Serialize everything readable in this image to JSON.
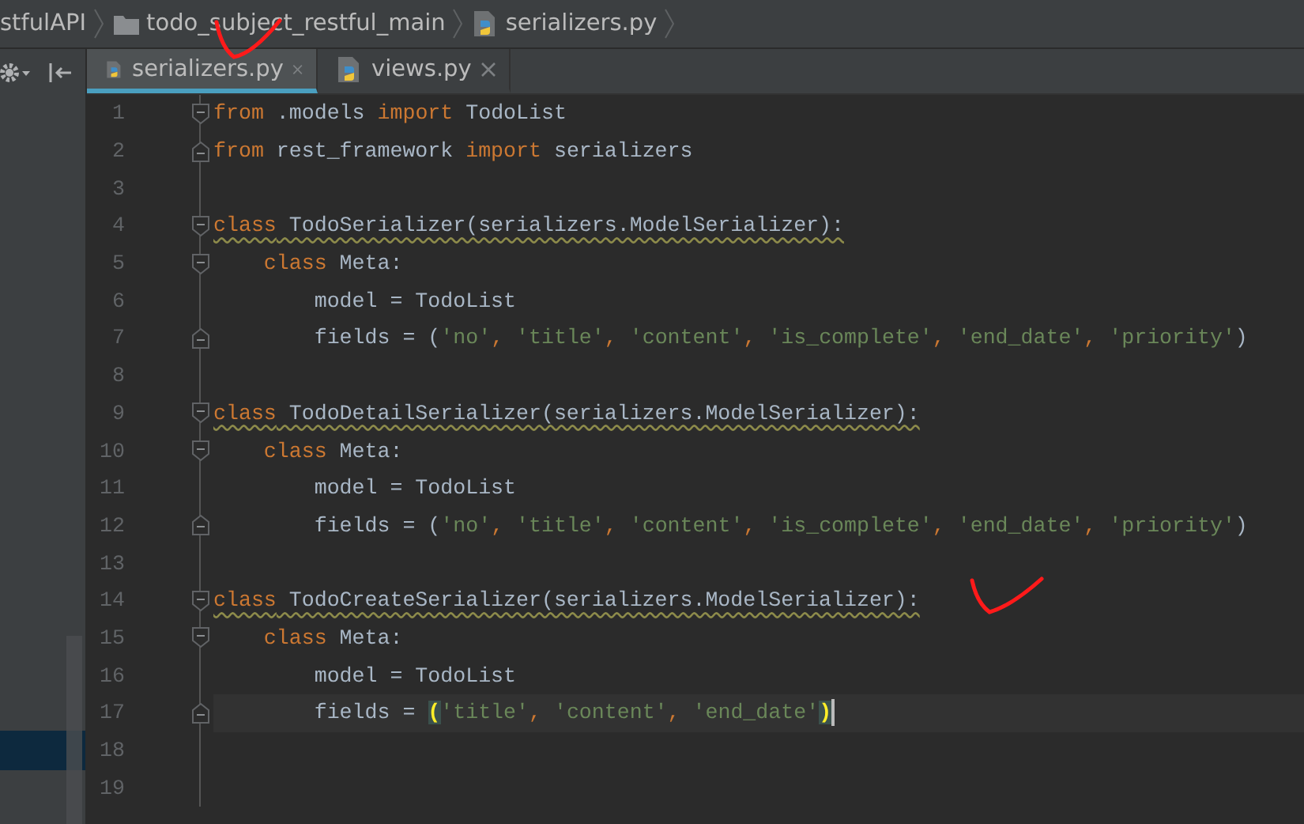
{
  "breadcrumbs": [
    {
      "kind": "project",
      "label": "stfulAPI"
    },
    {
      "kind": "folder",
      "label": "todo_subject_restful_main"
    },
    {
      "kind": "python-file",
      "label": "serializers.py"
    }
  ],
  "tabs": [
    {
      "label": "serializers.py",
      "selected": true
    },
    {
      "label": "views.py",
      "selected": false
    }
  ],
  "editor": {
    "lines": [
      {
        "number": "1",
        "fold_start": true,
        "fold_end": false,
        "warning": false,
        "current": false,
        "tokens": [
          {
            "kind": "keyword",
            "text": "from"
          },
          {
            "kind": "plain",
            "text": " .models "
          },
          {
            "kind": "keyword",
            "text": "import"
          },
          {
            "kind": "plain",
            "text": " TodoList"
          }
        ]
      },
      {
        "number": "2",
        "fold_start": false,
        "fold_end": true,
        "warning": false,
        "current": false,
        "tokens": [
          {
            "kind": "keyword",
            "text": "from"
          },
          {
            "kind": "plain",
            "text": " rest_framework "
          },
          {
            "kind": "keyword",
            "text": "import"
          },
          {
            "kind": "plain",
            "text": " serializers"
          }
        ]
      },
      {
        "number": "3",
        "fold_start": false,
        "fold_end": false,
        "current": false
      },
      {
        "number": "4",
        "fold_start": true,
        "fold_end": false,
        "warning": true,
        "current": false,
        "tokens": [
          {
            "kind": "keyword",
            "text": "class"
          },
          {
            "kind": "plain",
            "text": " TodoSerializer(serializers.ModelSerializer):"
          }
        ]
      },
      {
        "number": "5",
        "fold_start": true,
        "fold_end": false,
        "warning": false,
        "current": false,
        "tokens": [
          {
            "kind": "keyword",
            "text": "    class"
          },
          {
            "kind": "plain",
            "text": " Meta:"
          }
        ]
      },
      {
        "number": "6",
        "fold_start": false,
        "fold_end": false,
        "warning": false,
        "current": false,
        "tokens": [
          {
            "kind": "plain",
            "text": "        model = TodoList"
          }
        ]
      },
      {
        "number": "7",
        "fold_start": false,
        "fold_end": true,
        "warning": false,
        "current": false,
        "tokens": [
          {
            "kind": "plain",
            "text": "        fields = ("
          },
          {
            "kind": "string",
            "text": "'no'"
          },
          {
            "kind": "keyword",
            "text": ", "
          },
          {
            "kind": "string",
            "text": "'title'"
          },
          {
            "kind": "keyword",
            "text": ", "
          },
          {
            "kind": "string",
            "text": "'content'"
          },
          {
            "kind": "keyword",
            "text": ", "
          },
          {
            "kind": "string",
            "text": "'is_complete'"
          },
          {
            "kind": "keyword",
            "text": ", "
          },
          {
            "kind": "string",
            "text": "'end_date'"
          },
          {
            "kind": "keyword",
            "text": ", "
          },
          {
            "kind": "string",
            "text": "'priority'"
          },
          {
            "kind": "plain",
            "text": ")"
          }
        ]
      },
      {
        "number": "8",
        "fold_start": false,
        "fold_end": false,
        "current": false
      },
      {
        "number": "9",
        "fold_start": true,
        "fold_end": false,
        "warning": true,
        "current": false,
        "tokens": [
          {
            "kind": "keyword",
            "text": "class"
          },
          {
            "kind": "plain",
            "text": " TodoDetailSerializer(serializers.ModelSerializer):"
          }
        ]
      },
      {
        "number": "10",
        "fold_start": true,
        "fold_end": false,
        "warning": false,
        "current": false,
        "tokens": [
          {
            "kind": "keyword",
            "text": "    class"
          },
          {
            "kind": "plain",
            "text": " Meta:"
          }
        ]
      },
      {
        "number": "11",
        "fold_start": false,
        "fold_end": false,
        "warning": false,
        "current": false,
        "tokens": [
          {
            "kind": "plain",
            "text": "        model = TodoList"
          }
        ]
      },
      {
        "number": "12",
        "fold_start": false,
        "fold_end": true,
        "warning": false,
        "current": false,
        "tokens": [
          {
            "kind": "plain",
            "text": "        fields = ("
          },
          {
            "kind": "string",
            "text": "'no'"
          },
          {
            "kind": "keyword",
            "text": ", "
          },
          {
            "kind": "string",
            "text": "'title'"
          },
          {
            "kind": "keyword",
            "text": ", "
          },
          {
            "kind": "string",
            "text": "'content'"
          },
          {
            "kind": "keyword",
            "text": ", "
          },
          {
            "kind": "string",
            "text": "'is_complete'"
          },
          {
            "kind": "keyword",
            "text": ", "
          },
          {
            "kind": "string",
            "text": "'end_date'"
          },
          {
            "kind": "keyword",
            "text": ", "
          },
          {
            "kind": "string",
            "text": "'priority'"
          },
          {
            "kind": "plain",
            "text": ")"
          }
        ]
      },
      {
        "number": "13",
        "fold_start": false,
        "fold_end": false,
        "current": false
      },
      {
        "number": "14",
        "fold_start": true,
        "fold_end": false,
        "warning": true,
        "current": false,
        "tokens": [
          {
            "kind": "keyword",
            "text": "class"
          },
          {
            "kind": "plain",
            "text": " TodoCreateSerializer(serializers.ModelSerializer):"
          }
        ]
      },
      {
        "number": "15",
        "fold_start": true,
        "fold_end": false,
        "warning": false,
        "current": false,
        "tokens": [
          {
            "kind": "keyword",
            "text": "    class"
          },
          {
            "kind": "plain",
            "text": " Meta:"
          }
        ]
      },
      {
        "number": "16",
        "fold_start": false,
        "fold_end": false,
        "warning": false,
        "current": false,
        "tokens": [
          {
            "kind": "plain",
            "text": "        model = TodoList"
          }
        ]
      },
      {
        "number": "17",
        "fold_start": false,
        "fold_end": true,
        "warning": false,
        "current": true,
        "tokens": [
          {
            "kind": "plain",
            "text": "        fields = "
          },
          {
            "kind": "bracket",
            "text": "("
          },
          {
            "kind": "string",
            "text": "'title'"
          },
          {
            "kind": "keyword",
            "text": ", "
          },
          {
            "kind": "string",
            "text": "'content'"
          },
          {
            "kind": "keyword",
            "text": ", "
          },
          {
            "kind": "string",
            "text": "'end_date'"
          },
          {
            "kind": "bracket",
            "text": ")"
          }
        ]
      },
      {
        "number": "18",
        "fold_start": false,
        "fold_end": false,
        "current": false
      },
      {
        "number": "19",
        "fold_start": false,
        "fold_end": false,
        "current": false
      }
    ]
  }
}
